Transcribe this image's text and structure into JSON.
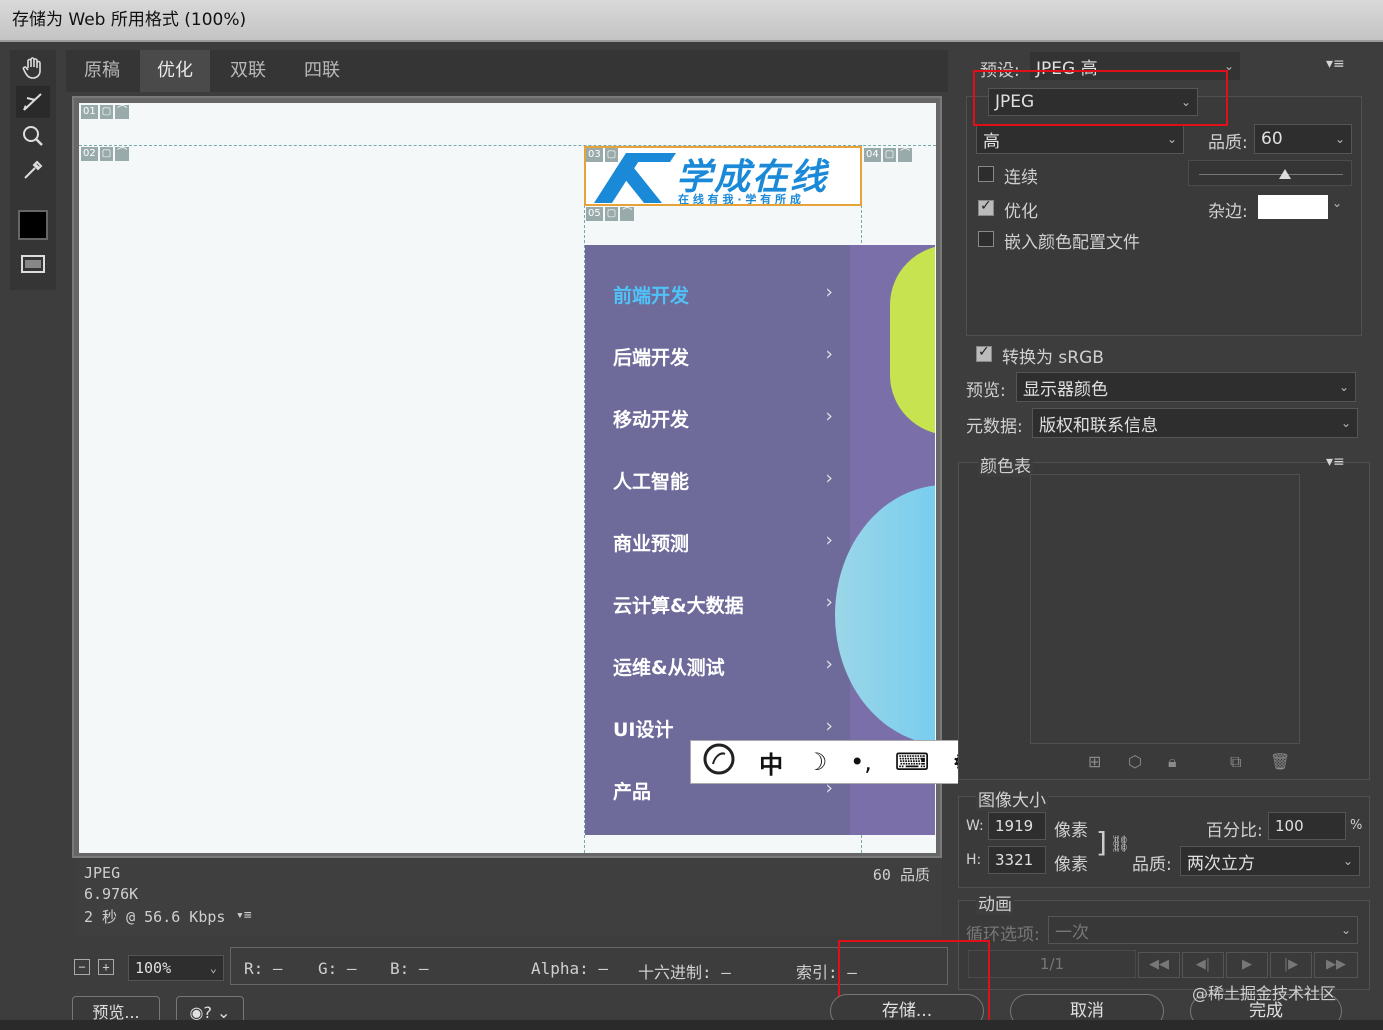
{
  "window": {
    "title": "存储为 Web 所用格式 (100%)"
  },
  "tools": [
    {
      "icon": "hand-icon"
    },
    {
      "icon": "slice-select-icon"
    },
    {
      "icon": "zoom-icon"
    },
    {
      "icon": "eyedropper-icon"
    },
    {
      "icon": "color-swatch-icon"
    },
    {
      "icon": "toggle-slices-icon"
    }
  ],
  "tabs": [
    "原稿",
    "优化",
    "双联",
    "四联"
  ],
  "active_tab": "优化",
  "canvas": {
    "slices": [
      "01",
      "02",
      "03",
      "04",
      "05"
    ],
    "logo": {
      "title": "学成在线",
      "tagline": "在 线 有 我 · 学 有 所 成"
    },
    "menu": [
      "前端开发",
      "后端开发",
      "移动开发",
      "人工智能",
      "商业预测",
      "云计算&大数据",
      "运维&从测试",
      "UI设计",
      "产品"
    ],
    "menu_active_color": "#4fc3f7",
    "chevron": "›"
  },
  "info": {
    "format": "JPEG",
    "size": "6.976K",
    "time": "2 秒 @ 56.6 Kbps",
    "quality_label": "60 品质"
  },
  "status": {
    "zoom": "100%",
    "r": "R: —",
    "g": "G: —",
    "b": "B: —",
    "alpha": "Alpha: —",
    "hex": "十六进制: —",
    "index": "索引: —"
  },
  "preset": {
    "label": "预设:",
    "value": "JPEG 高"
  },
  "format_select": "JPEG",
  "quality_level": "高",
  "quality": {
    "label": "品质:",
    "value": "60"
  },
  "options": {
    "progressive": {
      "label": "连续",
      "checked": false
    },
    "optimized": {
      "label": "优化",
      "checked": true
    },
    "embed_profile": {
      "label": "嵌入颜色配置文件",
      "checked": false
    },
    "matte_label": "杂边:",
    "convert_srgb": {
      "label": "转换为 sRGB",
      "checked": true
    }
  },
  "preview": {
    "label": "预览:",
    "value": "显示器颜色"
  },
  "metadata": {
    "label": "元数据:",
    "value": "版权和联系信息"
  },
  "color_table": {
    "label": "颜色表"
  },
  "image_size": {
    "label": "图像大小",
    "w_label": "W:",
    "w": "1919",
    "w_unit": "像素",
    "h_label": "H:",
    "h": "3321",
    "h_unit": "像素",
    "percent_label": "百分比:",
    "percent": "100",
    "percent_unit": "%",
    "quality_label": "品质:",
    "quality": "两次立方"
  },
  "animation": {
    "label": "动画",
    "loop_label": "循环选项:",
    "loop": "一次",
    "frame": "1/1"
  },
  "buttons": {
    "preview": "预览...",
    "save": "存储...",
    "cancel": "取消",
    "done": "完成"
  },
  "watermark": "@稀土掘金技术社区",
  "ime": {
    "lang": "中"
  }
}
